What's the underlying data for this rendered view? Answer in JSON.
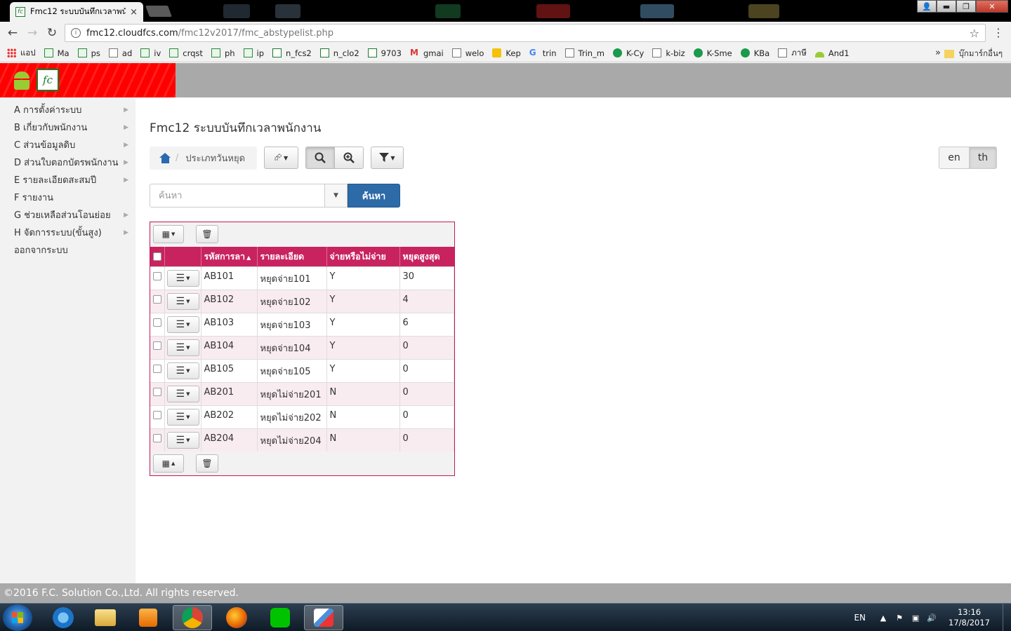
{
  "browser": {
    "tab_title": "Fmc12 ระบบบันทึกเวลาพนักงาน",
    "tab_close": "×",
    "url_host": "fmc12.cloudfcs.com",
    "url_path": "/fmc12v2017/fmc_abstypelist.php",
    "window_controls": {
      "minimize": "▬",
      "restore": "❐",
      "close": "✕"
    },
    "bookmarks": [
      {
        "label": "แอป",
        "icon": "apps-grid-icon"
      },
      {
        "label": "Ma",
        "icon": "sheets-icon"
      },
      {
        "label": "ps",
        "icon": "sheets-icon"
      },
      {
        "label": "ad",
        "icon": "page-icon"
      },
      {
        "label": "iv",
        "icon": "sheets-icon"
      },
      {
        "label": "crqst",
        "icon": "sheets-icon"
      },
      {
        "label": "ph",
        "icon": "sheets-icon"
      },
      {
        "label": "ip",
        "icon": "sheets-icon"
      },
      {
        "label": "n_fcs2",
        "icon": "fc-icon"
      },
      {
        "label": "n_clo2",
        "icon": "fc-icon"
      },
      {
        "label": "9703",
        "icon": "fc-icon"
      },
      {
        "label": "gmai",
        "icon": "gmail-icon"
      },
      {
        "label": "welo",
        "icon": "page-icon"
      },
      {
        "label": "Kep",
        "icon": "keep-icon"
      },
      {
        "label": "trin",
        "icon": "google-icon"
      },
      {
        "label": "Trin_m",
        "icon": "page-icon"
      },
      {
        "label": "K-Cy",
        "icon": "kbank-icon"
      },
      {
        "label": "k-biz",
        "icon": "page-icon"
      },
      {
        "label": "K-Sme",
        "icon": "kbank-icon"
      },
      {
        "label": "KBa",
        "icon": "kbank-icon"
      },
      {
        "label": "ภาษี",
        "icon": "page-icon"
      },
      {
        "label": "And1",
        "icon": "android-icon"
      }
    ],
    "bookmarks_more": "»",
    "other_bookmarks": "บุ๊กมาร์กอื่นๆ"
  },
  "sidebar": {
    "items": [
      {
        "label": "A การตั้งค่าระบบ",
        "has_submenu": true
      },
      {
        "label": "B เกี่ยวกับพนักงาน",
        "has_submenu": true
      },
      {
        "label": "C ส่วนข้อมูลดิบ",
        "has_submenu": true
      },
      {
        "label": "D ส่วนใบตอกบัตรพนักงาน",
        "has_submenu": true
      },
      {
        "label": "E รายละเอียดสะสมปี",
        "has_submenu": true
      },
      {
        "label": "F รายงาน",
        "has_submenu": false
      },
      {
        "label": "G ช่วยเหลือส่วนโอนย่อย",
        "has_submenu": true
      },
      {
        "label": "H จัดการระบบ(ขั้นสูง)",
        "has_submenu": true
      },
      {
        "label": "ออกจากระบบ",
        "has_submenu": false
      }
    ]
  },
  "page": {
    "title": "Fmc12 ระบบบันทึกเวลาพนักงาน",
    "breadcrumb": "ประเภทวันหยุด",
    "breadcrumb_sep": "/",
    "lang_en": "en",
    "lang_th": "th",
    "search_placeholder": "ค้นหา",
    "search_button": "ค้นหา"
  },
  "grid": {
    "columns": [
      "รหัสการลา",
      "รายละเอียด",
      "จ่ายหรือไม่จ่าย",
      "หยุดสูงสุด"
    ],
    "sort_indicator": "▲",
    "rows": [
      [
        "AB101",
        "หยุดจ่าย101",
        "Y",
        "30"
      ],
      [
        "AB102",
        "หยุดจ่าย102",
        "Y",
        "4"
      ],
      [
        "AB103",
        "หยุดจ่าย103",
        "Y",
        "6"
      ],
      [
        "AB104",
        "หยุดจ่าย104",
        "Y",
        "0"
      ],
      [
        "AB105",
        "หยุดจ่าย105",
        "Y",
        "0"
      ],
      [
        "AB201",
        "หยุดไม่จ่าย201",
        "N",
        "0"
      ],
      [
        "AB202",
        "หยุดไม่จ่าย202",
        "N",
        "0"
      ],
      [
        "AB204",
        "หยุดไม่จ่าย204",
        "N",
        "0"
      ]
    ]
  },
  "footer": {
    "text": "©2016 F.C. Solution Co.,Ltd. All rights reserved."
  },
  "taskbar": {
    "lang": "EN",
    "time": "13:16",
    "date": "17/8/2017"
  },
  "colors": {
    "header_red": "#ff0000",
    "grid_header": "#c8235f",
    "search_button": "#2d6aa8"
  }
}
